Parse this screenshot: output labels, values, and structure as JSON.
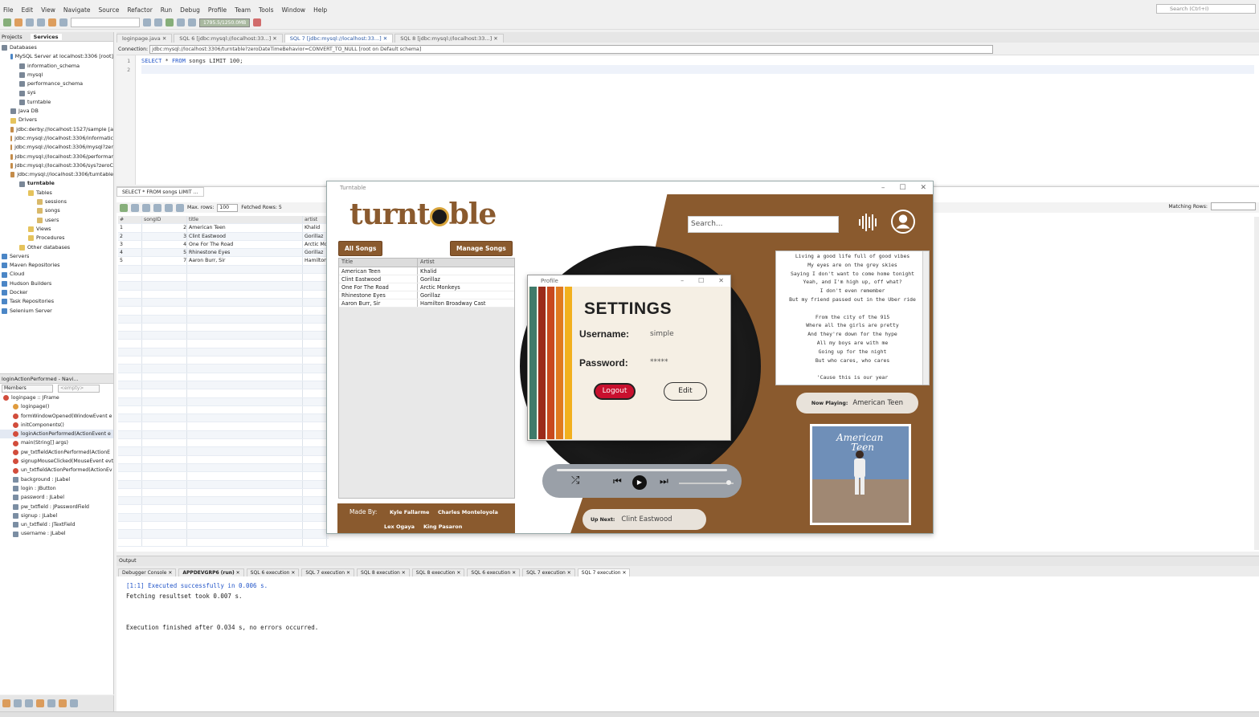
{
  "ide": {
    "menu": [
      "File",
      "Edit",
      "View",
      "Navigate",
      "Source",
      "Refactor",
      "Run",
      "Debug",
      "Profile",
      "Team",
      "Tools",
      "Window",
      "Help"
    ],
    "search_placeholder": "Search (Ctrl+I)",
    "memory": "1795.5/1250.0MB"
  },
  "left_panel": {
    "tabs": [
      "Projects",
      "Services"
    ],
    "tree": [
      {
        "label": "Databases",
        "indent": 0,
        "icon": "database-icon"
      },
      {
        "label": "MySQL Server at localhost:3306 [root]",
        "indent": 1,
        "icon": "server-icon"
      },
      {
        "label": "information_schema",
        "indent": 2,
        "icon": "database-icon"
      },
      {
        "label": "mysql",
        "indent": 2,
        "icon": "database-icon"
      },
      {
        "label": "performance_schema",
        "indent": 2,
        "icon": "database-icon"
      },
      {
        "label": "sys",
        "indent": 2,
        "icon": "database-icon"
      },
      {
        "label": "turntable",
        "indent": 2,
        "icon": "database-icon"
      },
      {
        "label": "Java DB",
        "indent": 1,
        "icon": "database-icon"
      },
      {
        "label": "Drivers",
        "indent": 1,
        "icon": "folder-icon"
      },
      {
        "label": "jdbc:derby://localhost:1527/sample [a",
        "indent": 1,
        "icon": "connection-icon"
      },
      {
        "label": "jdbc:mysql://localhost:3306/informatic",
        "indent": 1,
        "icon": "connection-icon"
      },
      {
        "label": "jdbc:mysql://localhost:3306/mysql?zer",
        "indent": 1,
        "icon": "connection-icon"
      },
      {
        "label": "jdbc:mysql://localhost:3306/performar",
        "indent": 1,
        "icon": "connection-icon"
      },
      {
        "label": "jdbc:mysql://localhost:3306/sys?zeroC",
        "indent": 1,
        "icon": "connection-icon"
      },
      {
        "label": "jdbc:mysql://localhost:3306/turntable",
        "indent": 1,
        "icon": "connection-icon"
      },
      {
        "label": "turntable",
        "indent": 2,
        "icon": "database-icon"
      },
      {
        "label": "Tables",
        "indent": 3,
        "icon": "folder-icon"
      },
      {
        "label": "sessions",
        "indent": 4,
        "icon": "table-icon"
      },
      {
        "label": "songs",
        "indent": 4,
        "icon": "table-icon"
      },
      {
        "label": "users",
        "indent": 4,
        "icon": "table-icon"
      },
      {
        "label": "Views",
        "indent": 3,
        "icon": "folder-icon"
      },
      {
        "label": "Procedures",
        "indent": 3,
        "icon": "folder-icon"
      },
      {
        "label": "Other databases",
        "indent": 2,
        "icon": "folder-icon"
      },
      {
        "label": "Servers",
        "indent": 0,
        "icon": "server-icon"
      },
      {
        "label": "Maven Repositories",
        "indent": 0,
        "icon": "repository-icon"
      },
      {
        "label": "Cloud",
        "indent": 0,
        "icon": "cloud-icon"
      },
      {
        "label": "Hudson Builders",
        "indent": 0,
        "icon": "builder-icon"
      },
      {
        "label": "Docker",
        "indent": 0,
        "icon": "docker-icon"
      },
      {
        "label": "Task Repositories",
        "indent": 0,
        "icon": "task-icon"
      },
      {
        "label": "Selenium Server",
        "indent": 0,
        "icon": "server-icon"
      }
    ]
  },
  "navigator": {
    "title": "loginActionPerformed - Navi...",
    "members": "Members",
    "filter": "<empty>",
    "items": [
      {
        "label": "loginpage :: JFrame",
        "type": "class"
      },
      {
        "label": "loginpage()",
        "type": "ctor"
      },
      {
        "label": "formWindowOpened(WindowEvent e",
        "type": "method"
      },
      {
        "label": "initComponents()",
        "type": "method"
      },
      {
        "label": "loginActionPerformed(ActionEvent e",
        "type": "method"
      },
      {
        "label": "main(String[] args)",
        "type": "method"
      },
      {
        "label": "pw_txtfieldActionPerformed(ActionE",
        "type": "method"
      },
      {
        "label": "signupMouseClicked(MouseEvent evt",
        "type": "method"
      },
      {
        "label": "un_txtfieldActionPerformed(ActionEv",
        "type": "method"
      },
      {
        "label": "background : JLabel",
        "type": "field"
      },
      {
        "label": "login : JButton",
        "type": "field"
      },
      {
        "label": "password : JLabel",
        "type": "field"
      },
      {
        "label": "pw_txtfield : JPasswordField",
        "type": "field"
      },
      {
        "label": "signup : JLabel",
        "type": "field"
      },
      {
        "label": "un_txtfield : JTextField",
        "type": "field"
      },
      {
        "label": "username : JLabel",
        "type": "field"
      }
    ]
  },
  "editor": {
    "tabs": [
      "loginpage.java",
      "SQL 6 [jdbc:mysql://localhost:33...]",
      "SQL 7 [jdbc:mysql://localhost:33...]",
      "SQL 8 [jdbc:mysql://localhost:33...]"
    ],
    "connection_label": "Connection:",
    "connection": "jdbc:mysql://localhost:3306/turntable?zeroDateTimeBehavior=CONVERT_TO_NULL [root on Default schema]",
    "line_numbers": [
      "1",
      "2"
    ],
    "code_kw1": "SELECT",
    "code_mid": " * ",
    "code_kw2": "FROM",
    "code_rest": " songs LIMIT 100;"
  },
  "results": {
    "tab": "SELECT * FROM songs LIMIT ...",
    "max_rows_label": "Max. rows:",
    "max_rows": "100",
    "fetched": "Fetched Rows: 5",
    "matching": "Matching Rows:",
    "columns": [
      "#",
      "songID",
      "title",
      "artist"
    ],
    "rows": [
      [
        "1",
        "2",
        "American Teen",
        "Khalid"
      ],
      [
        "2",
        "3",
        "Clint Eastwood",
        "Gorillaz"
      ],
      [
        "3",
        "4",
        "One For The Road",
        "Arctic Mon"
      ],
      [
        "4",
        "5",
        "Rhinestone Eyes",
        "Gorillaz"
      ],
      [
        "5",
        "7",
        "Aaron Burr, Sir",
        "Hamilton"
      ]
    ]
  },
  "output": {
    "title": "Output",
    "tabs": [
      "Debugger Console",
      "APPDEVGRP6 (run)",
      "SQL 6 execution",
      "SQL 7 execution",
      "SQL 8 execution",
      "SQL 8 execution",
      "SQL 6 execution",
      "SQL 7 execution",
      "SQL 7 execution"
    ],
    "lines": [
      "[1:1] Executed successfully in 0.006 s.",
      "Fetching resultset took 0.007 s.",
      "",
      "",
      "Execution finished after 0.034 s, no errors occurred."
    ]
  },
  "turntable": {
    "window_title": "Turntable",
    "logo_a": "turnt",
    "logo_b": "ble",
    "all_songs": "All Songs",
    "manage_songs": "Manage Songs",
    "table_columns": [
      "Title",
      "Artist"
    ],
    "songs": [
      [
        "American Teen",
        "Khalid"
      ],
      [
        "Clint Eastwood",
        "Gorillaz"
      ],
      [
        "One For The Road",
        "Arctic Monkeys"
      ],
      [
        "Rhinestone Eyes",
        "Gorillaz"
      ],
      [
        "Aaron Burr, Sir",
        "Hamilton Broadway Cast"
      ]
    ],
    "made_by_label": "Made By:",
    "authors": [
      "Kyle Fallarme",
      "Charles Monteloyola",
      "Lex Ogaya",
      "King Pasaron"
    ],
    "search_placeholder": "Search...",
    "lyrics": [
      "Living a good life full of good vibes",
      "My eyes are on the grey skies",
      "Saying I don't want to come home tonight",
      "Yeah, and I'm high up, off what?",
      "I don't even remember",
      "But my friend passed out in the Uber ride",
      "",
      "From the city of the 915",
      "Where all the girls are pretty",
      "And they're down for the hype",
      "All my boys are with me",
      "Going up for the night",
      "But who cares, who cares",
      "",
      "'Cause this is our year"
    ],
    "now_playing_label": "Now Playing:",
    "now_playing": "American Teen",
    "up_next_label": "Up Next:",
    "up_next": "Clint Eastwood",
    "album_title_line1": "American",
    "album_title_line2": "Teen"
  },
  "profile": {
    "window_title": "Profile",
    "heading": "SETTINGS",
    "username_label": "Username:",
    "username": "simple",
    "password_label": "Password:",
    "password": "*****",
    "logout": "Logout",
    "edit": "Edit",
    "stripe_colors": [
      "#3f7a6a",
      "#9c2b1a",
      "#c8491e",
      "#e07a1f",
      "#f2b01e"
    ]
  }
}
